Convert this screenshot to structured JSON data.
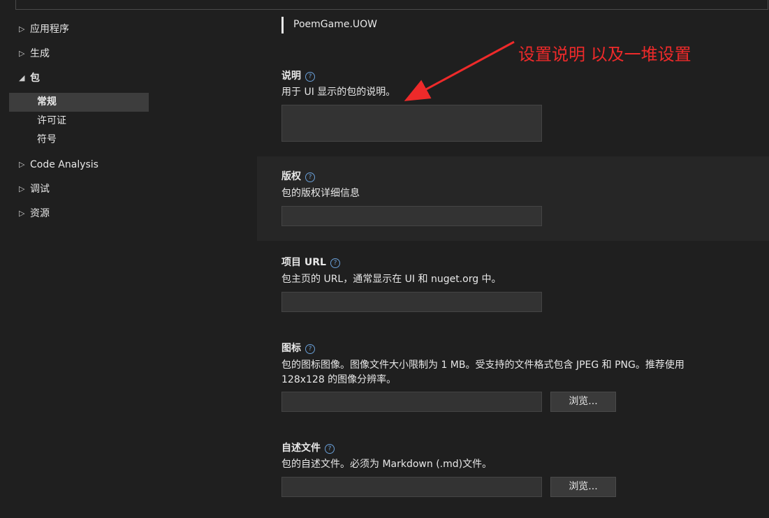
{
  "nav": {
    "items": [
      {
        "label": "应用程序",
        "arrow": "▷"
      },
      {
        "label": "生成",
        "arrow": "▷"
      },
      {
        "label": "包",
        "arrow": "◢"
      },
      {
        "label": "Code Analysis",
        "arrow": "▷"
      },
      {
        "label": "调试",
        "arrow": "▷"
      },
      {
        "label": "资源",
        "arrow": "▷"
      }
    ],
    "sub_items": [
      {
        "label": "常规"
      },
      {
        "label": "许可证"
      },
      {
        "label": "符号"
      }
    ]
  },
  "main": {
    "package_name": "PoemGame.UOW",
    "help_glyph": "?",
    "description": {
      "title": "说明",
      "desc": "用于 UI 显示的包的说明。",
      "value": ""
    },
    "copyright": {
      "title": "版权",
      "desc": "包的版权详细信息",
      "value": ""
    },
    "project_url": {
      "title": "项目 URL",
      "desc": "包主页的 URL，通常显示在 UI 和 nuget.org 中。",
      "value": ""
    },
    "icon": {
      "title": "图标",
      "desc": "包的图标图像。图像文件大小限制为 1 MB。受支持的文件格式包含 JPEG 和 PNG。推荐使用 128x128 的图像分辨率。",
      "value": "",
      "browse_label": "浏览..."
    },
    "readme": {
      "title": "自述文件",
      "desc": "包的自述文件。必须为 Markdown (.md)文件。",
      "value": "",
      "browse_label": "浏览..."
    }
  },
  "annotation": {
    "text": "设置说明 以及一堆设置",
    "color": "#ee2a2a"
  }
}
